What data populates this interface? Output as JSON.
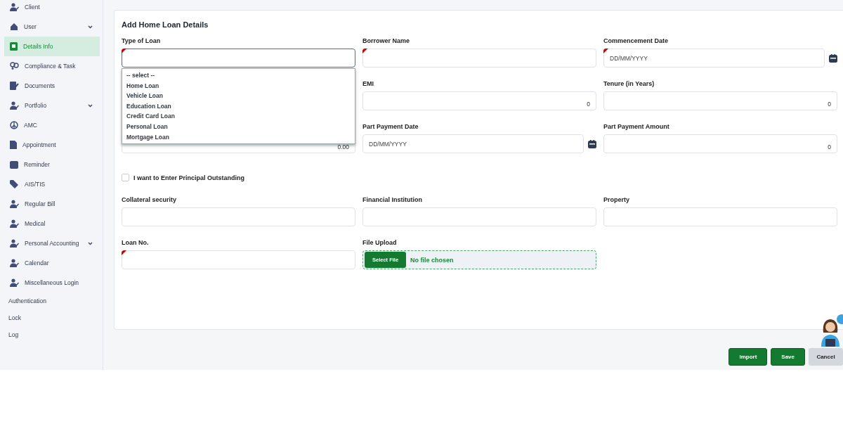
{
  "sidebar": {
    "items": [
      {
        "label": "Client",
        "selected": false,
        "has_submenu": false
      },
      {
        "label": "User",
        "selected": false,
        "has_submenu": true
      },
      {
        "label": "Details Info",
        "selected": true,
        "has_submenu": false
      },
      {
        "label": "Compliance & Task",
        "selected": false,
        "has_submenu": false
      },
      {
        "label": "Documents",
        "selected": false,
        "has_submenu": false
      },
      {
        "label": "Portfolio",
        "selected": false,
        "has_submenu": true
      },
      {
        "label": "AMC",
        "selected": false,
        "has_submenu": false
      },
      {
        "label": "Appointment",
        "selected": false,
        "has_submenu": false
      },
      {
        "label": "Reminder",
        "selected": false,
        "has_submenu": false
      },
      {
        "label": "AIS/TIS",
        "selected": false,
        "has_submenu": false
      },
      {
        "label": "Regular Bill",
        "selected": false,
        "has_submenu": false
      },
      {
        "label": "Medical",
        "selected": false,
        "has_submenu": false
      },
      {
        "label": "Personal Accounting",
        "selected": false,
        "has_submenu": true
      },
      {
        "label": "Calendar",
        "selected": false,
        "has_submenu": false
      },
      {
        "label": "Miscellaneous Login",
        "selected": false,
        "has_submenu": false
      },
      {
        "label": "Authentication",
        "selected": false,
        "has_submenu": false
      },
      {
        "label": "Lock",
        "selected": false,
        "has_submenu": false
      },
      {
        "label": "Log",
        "selected": false,
        "has_submenu": false
      }
    ]
  },
  "form": {
    "title": "Add Home Loan Details",
    "rows": [
      [
        {
          "kind": "select",
          "label": "Type of Loan",
          "required": true,
          "focused": true,
          "options": [
            "-- select --",
            "Home Loan",
            "Vehicle Loan",
            "Education Loan",
            "Credit Card Loan",
            "Personal Loan",
            "Mortgage Loan"
          ]
        },
        {
          "kind": "text",
          "label": "Borrower Name",
          "required": true,
          "focused": false
        },
        {
          "kind": "date",
          "label": "Commencement Date",
          "required": true,
          "focused": false,
          "placeholder": "DD/MM/YYYY"
        }
      ],
      [
        null,
        {
          "kind": "number",
          "label": "EMI",
          "required": false,
          "focused": false,
          "value": "0"
        },
        {
          "kind": "number",
          "label": "Tenure (in Years)",
          "required": false,
          "focused": false,
          "value": "0"
        }
      ],
      [
        {
          "kind": "number",
          "value": "0.00"
        },
        {
          "kind": "date",
          "label": "Part Payment Date",
          "required": false,
          "focused": false,
          "placeholder": "DD/MM/YYYY"
        },
        {
          "kind": "number",
          "label": "Part Payment Amount",
          "required": false,
          "focused": false,
          "value": "0"
        }
      ],
      [
        {
          "kind": "checkbox",
          "label": "I want to Enter Principal Outstanding",
          "checked": false
        }
      ],
      [
        {
          "kind": "text",
          "label": "Collateral security",
          "required": false,
          "focused": false
        },
        {
          "kind": "text",
          "label": "Financial Institution",
          "required": false,
          "focused": false
        },
        {
          "kind": "text",
          "label": "Property",
          "required": false,
          "focused": false
        }
      ],
      [
        {
          "kind": "text",
          "label": "Loan No.",
          "required": true,
          "focused": false
        },
        {
          "kind": "file",
          "label": "File Upload",
          "button": "Select File",
          "status": "No file chosen"
        }
      ]
    ]
  },
  "actions": [
    {
      "label": "Import",
      "kind": "primary"
    },
    {
      "label": "Save",
      "kind": "primary"
    },
    {
      "label": "Cancel",
      "kind": "secondary"
    }
  ]
}
